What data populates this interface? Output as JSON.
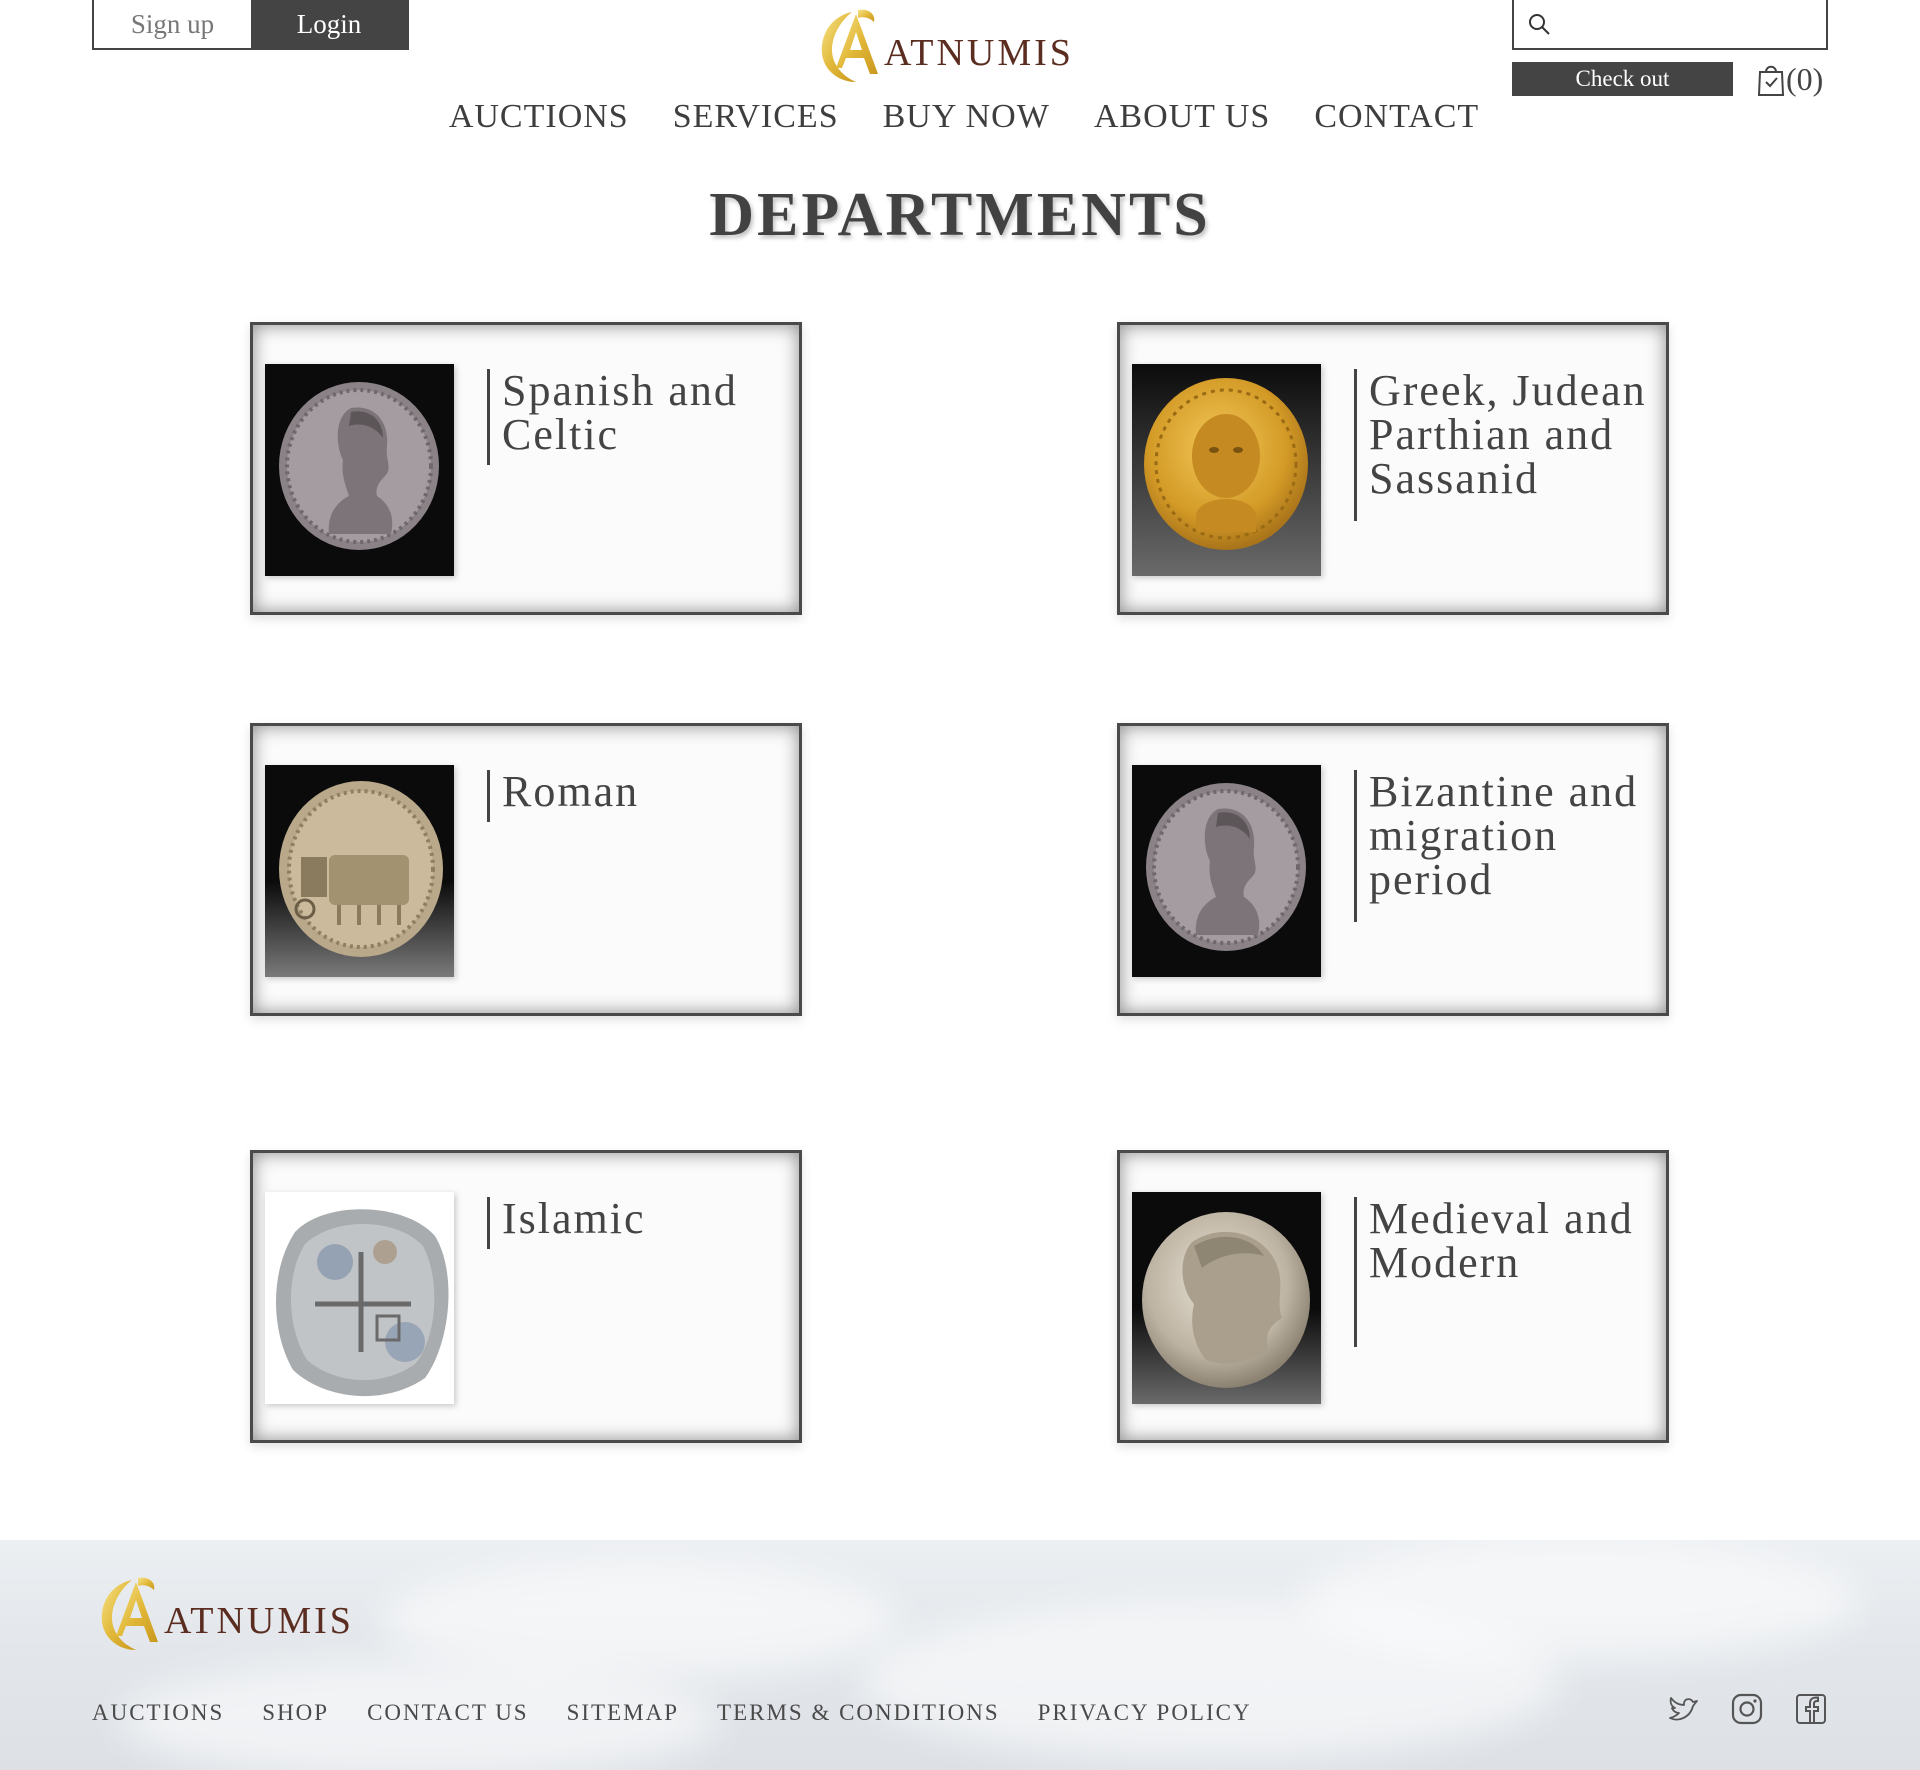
{
  "header": {
    "signup_label": "Sign up",
    "login_label": "Login",
    "logo_text": "ATNUMIS",
    "search_placeholder": "",
    "checkout_label": "Check out",
    "cart_count": "(0)"
  },
  "nav": {
    "items": [
      {
        "label": "AUCTIONS"
      },
      {
        "label": "SERVICES"
      },
      {
        "label": "BUY NOW"
      },
      {
        "label": "ABOUT US"
      },
      {
        "label": "CONTACT"
      }
    ]
  },
  "page": {
    "title": "DEPARTMENTS"
  },
  "departments": [
    {
      "name": "Spanish and Celtic",
      "lines": [
        "Spanish and",
        "Celtic"
      ],
      "coin": "silver-portrait-coin"
    },
    {
      "name": "Greek, Judean Parthian and Sassanid",
      "lines": [
        "Greek, Judean",
        "Parthian and",
        "Sassanid"
      ],
      "coin": "gold-portrait-coin"
    },
    {
      "name": "Roman",
      "lines": [
        "Roman"
      ],
      "coin": "quadriga-coin"
    },
    {
      "name": "Bizantine and migration period",
      "lines": [
        "Bizantine and",
        "migration",
        "period"
      ],
      "coin": "silver-portrait-coin"
    },
    {
      "name": "Islamic",
      "lines": [
        "Islamic"
      ],
      "coin": "cob-coin"
    },
    {
      "name": "Medieval and Modern",
      "lines": [
        "Medieval and",
        "Modern"
      ],
      "coin": "heracles-coin"
    }
  ],
  "footer": {
    "logo_text": "ATNUMIS",
    "links": [
      {
        "label": "AUCTIONS"
      },
      {
        "label": "SHOP"
      },
      {
        "label": "CONTACT US"
      },
      {
        "label": "SITEMAP"
      },
      {
        "label": "TERMS & CONDITIONS"
      },
      {
        "label": "PRIVACY POLICY"
      }
    ],
    "social": [
      "twitter-icon",
      "instagram-icon",
      "facebook-icon"
    ]
  },
  "colors": {
    "dark_button": "#444444",
    "logo_gold": "#e2b93a",
    "logo_text": "#5a2d20",
    "text": "#3e3e3e"
  }
}
